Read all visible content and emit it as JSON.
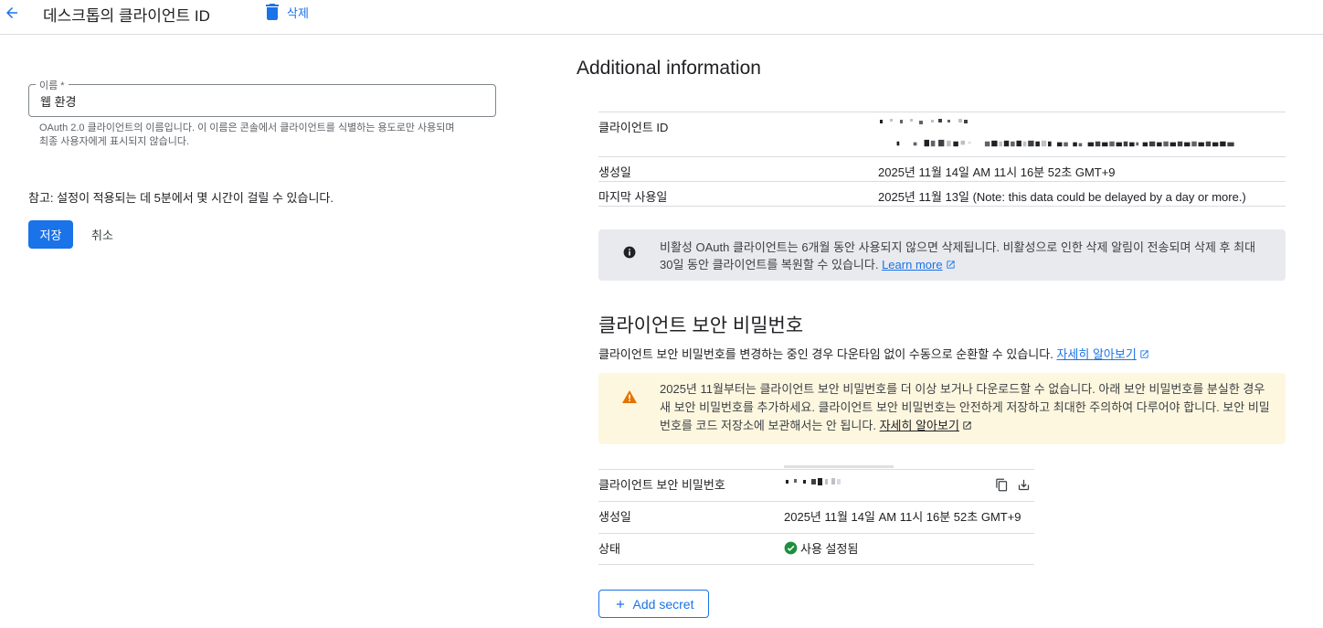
{
  "header": {
    "title": "데스크톱의 클라이언트 ID",
    "delete_label": "삭제"
  },
  "form": {
    "name_label": "이름 *",
    "name_value": "웹 환경",
    "helper_line1": "OAuth 2.0 클라이언트의 이름입니다. 이 이름은 콘솔에서 클라이언트를 식별하는 용도로만 사용되며",
    "helper_line2": "최종 사용자에게 표시되지 않습니다.",
    "note": "참고: 설정이 적용되는 데 5분에서 몇 시간이 걸릴 수 있습니다.",
    "save_label": "저장",
    "cancel_label": "취소"
  },
  "additional_info": {
    "title": "Additional information",
    "rows": [
      {
        "key": "클라이언트 ID",
        "value": ""
      },
      {
        "key": "생성일",
        "value": "2025년 11월 14일 AM 11시 16분 52초 GMT+9"
      },
      {
        "key": "마지막 사용일",
        "value": "2025년 11월 13일 (Note: this data could be delayed by a day or more.)"
      }
    ],
    "notice_text": "비활성 OAuth 클라이언트는 6개월 동안 사용되지 않으면 삭제됩니다. 비활성으로 인한 삭제 알림이 전송되며 삭제 후 최대 30일 동안 클라이언트를 복원할 수 있습니다.",
    "notice_link": "Learn more"
  },
  "client_secret": {
    "title": "클라이언트 보안 비밀번호",
    "desc": "클라이언트 보안 비밀번호를 변경하는 중인 경우 다운타임 없이 수동으로 순환할 수 있습니다.",
    "desc_link": "자세히 알아보기",
    "warning_text": "2025년 11월부터는 클라이언트 보안 비밀번호를 더 이상 보거나 다운로드할 수 없습니다. 아래 보안 비밀번호를 분실한 경우 새 보안 비밀번호를 추가하세요. 클라이언트 보안 비밀번호는 안전하게 저장하고 최대한 주의하여 다루어야 합니다. 보안 비밀번호를 코드 저장소에 보관해서는 안 됩니다.",
    "warning_link": "자세히 알아보기",
    "rows": [
      {
        "key": "클라이언트 보안 비밀번호",
        "value": ""
      },
      {
        "key": "생성일",
        "value": "2025년 11월 14일 AM 11시 16분 52초 GMT+9"
      },
      {
        "key": "상태",
        "value": "사용 설정됨"
      }
    ],
    "add_secret_label": "Add secret"
  },
  "colors": {
    "accent": "#1a73e8",
    "warning_bg": "#fef7e0",
    "warning_icon": "#e37400",
    "notice_bg": "#e8eaed",
    "status_ok": "#1e8e3e"
  },
  "icons": {
    "back": "arrow-left-icon",
    "delete": "trash-icon",
    "info": "info-icon",
    "warning": "warning-icon",
    "external": "open-in-new-icon",
    "copy": "copy-icon",
    "download": "download-icon",
    "check": "check-circle-icon",
    "add": "plus-icon"
  }
}
